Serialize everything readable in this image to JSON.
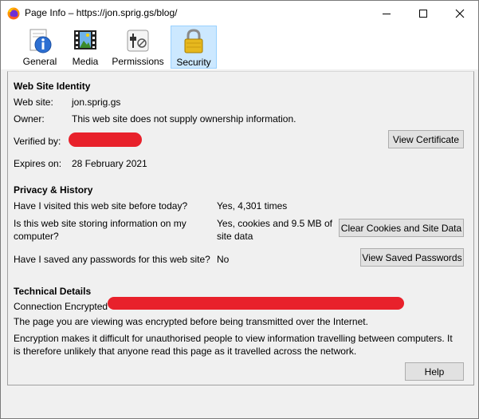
{
  "window": {
    "title": "Page Info – https://jon.sprig.gs/blog/",
    "minimize_icon": "minimize-icon",
    "maximize_icon": "maximize-icon",
    "close_icon": "close-icon"
  },
  "tabs": [
    {
      "label": "General",
      "icon": "info-icon",
      "active": false
    },
    {
      "label": "Media",
      "icon": "media-icon",
      "active": false
    },
    {
      "label": "Permissions",
      "icon": "permissions-icon",
      "active": false
    },
    {
      "label": "Security",
      "icon": "padlock-icon",
      "active": true
    }
  ],
  "identity": {
    "heading": "Web Site Identity",
    "website_label": "Web site:",
    "website_value": "jon.sprig.gs",
    "owner_label": "Owner:",
    "owner_value": "This web site does not supply ownership information.",
    "verified_label": "Verified by:",
    "expires_label": "Expires on:",
    "expires_value": "28 February 2021",
    "view_cert_button": "View Certificate"
  },
  "privacy": {
    "heading": "Privacy & History",
    "visited_q": "Have I visited this web site before today?",
    "visited_a": "Yes, 4,301 times",
    "storing_q1": "Is this web site storing information on my",
    "storing_q2": "computer?",
    "storing_a1": "Yes, cookies and 9.5 MB of",
    "storing_a2": "site data",
    "clear_button": "Clear Cookies and Site Data",
    "passwords_q": "Have I saved any passwords for this web site?",
    "passwords_a": "No",
    "view_passwords_button": "View Saved Passwords"
  },
  "technical": {
    "heading": "Technical Details",
    "connection": "Connection Encrypted",
    "line1": "The page you are viewing was encrypted before being transmitted over the Internet.",
    "line2": "Encryption makes it difficult for unauthorised people to view information travelling between computers. It",
    "line3": "is therefore unlikely that anyone read this page as it travelled across the network."
  },
  "help_button": "Help",
  "colors": {
    "redaction": "#e8212b",
    "active_tab": "#cce8ff"
  }
}
